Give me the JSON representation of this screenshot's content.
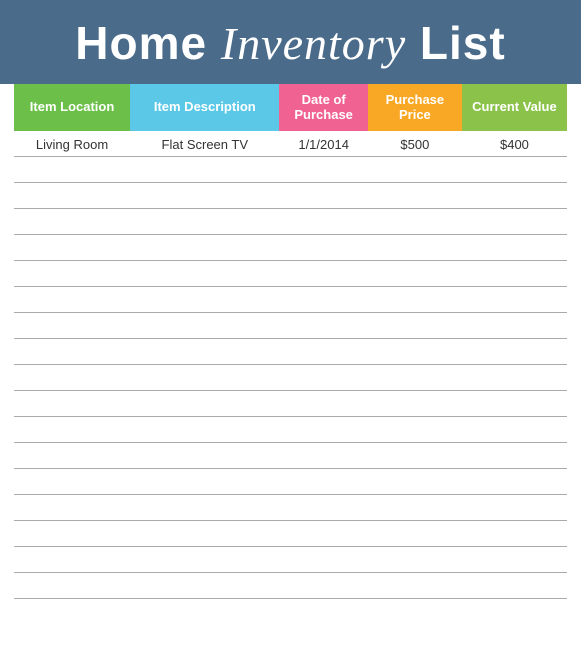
{
  "header": {
    "title_part1": "Home",
    "title_part2": "Inventory",
    "title_part3": "List"
  },
  "table": {
    "columns": [
      {
        "key": "location",
        "label": "Item Location",
        "color": "#6cc04a"
      },
      {
        "key": "description",
        "label": "Item Description",
        "color": "#5bc8e8"
      },
      {
        "key": "date",
        "label": "Date of Purchase",
        "color": "#f06292"
      },
      {
        "key": "purchase_price",
        "label": "Purchase Price",
        "color": "#f9a825"
      },
      {
        "key": "current_value",
        "label": "Current Value",
        "color": "#8bc34a"
      }
    ],
    "rows": [
      {
        "location": "Living Room",
        "description": "Flat Screen TV",
        "date": "1/1/2014",
        "purchase_price": "$500",
        "current_value": "$400"
      },
      {
        "location": "",
        "description": "",
        "date": "",
        "purchase_price": "",
        "current_value": ""
      },
      {
        "location": "",
        "description": "",
        "date": "",
        "purchase_price": "",
        "current_value": ""
      },
      {
        "location": "",
        "description": "",
        "date": "",
        "purchase_price": "",
        "current_value": ""
      },
      {
        "location": "",
        "description": "",
        "date": "",
        "purchase_price": "",
        "current_value": ""
      },
      {
        "location": "",
        "description": "",
        "date": "",
        "purchase_price": "",
        "current_value": ""
      },
      {
        "location": "",
        "description": "",
        "date": "",
        "purchase_price": "",
        "current_value": ""
      },
      {
        "location": "",
        "description": "",
        "date": "",
        "purchase_price": "",
        "current_value": ""
      },
      {
        "location": "",
        "description": "",
        "date": "",
        "purchase_price": "",
        "current_value": ""
      },
      {
        "location": "",
        "description": "",
        "date": "",
        "purchase_price": "",
        "current_value": ""
      },
      {
        "location": "",
        "description": "",
        "date": "",
        "purchase_price": "",
        "current_value": ""
      },
      {
        "location": "",
        "description": "",
        "date": "",
        "purchase_price": "",
        "current_value": ""
      },
      {
        "location": "",
        "description": "",
        "date": "",
        "purchase_price": "",
        "current_value": ""
      },
      {
        "location": "",
        "description": "",
        "date": "",
        "purchase_price": "",
        "current_value": ""
      },
      {
        "location": "",
        "description": "",
        "date": "",
        "purchase_price": "",
        "current_value": ""
      },
      {
        "location": "",
        "description": "",
        "date": "",
        "purchase_price": "",
        "current_value": ""
      },
      {
        "location": "",
        "description": "",
        "date": "",
        "purchase_price": "",
        "current_value": ""
      },
      {
        "location": "",
        "description": "",
        "date": "",
        "purchase_price": "",
        "current_value": ""
      }
    ]
  }
}
